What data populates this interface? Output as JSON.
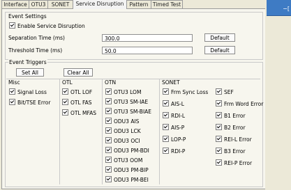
{
  "tabs": [
    "Interface",
    "OTU3",
    "SONET",
    "Service Disruption",
    "Pattern",
    "Timed Test"
  ],
  "active_tab": "Service Disruption",
  "right_glyph": "−[",
  "event_settings": {
    "title": "Event Settings",
    "enable_label": "Enable Service Disruption",
    "enable_checked": true,
    "separation_label": "Separation Time (ms)",
    "separation_value": "300.0",
    "threshold_label": "Threshold Time (ms)",
    "threshold_value": "50.0",
    "default_label": "Default"
  },
  "event_triggers": {
    "title": "Event Triggers",
    "set_all": "Set All",
    "clear_all": "Clear All",
    "misc": {
      "title": "Misc",
      "items": [
        {
          "label": "Signal Loss",
          "checked": true
        },
        {
          "label": "Bit/TSE Error",
          "checked": true
        }
      ]
    },
    "otl": {
      "title": "OTL",
      "items": [
        {
          "label": "OTL LOF",
          "checked": true
        },
        {
          "label": "OTL FAS",
          "checked": true
        },
        {
          "label": "OTL MFAS",
          "checked": true
        }
      ]
    },
    "otn": {
      "title": "OTN",
      "items": [
        {
          "label": "OTU3 LOM",
          "checked": true
        },
        {
          "label": "OTU3 SM-IAE",
          "checked": true
        },
        {
          "label": "OTU3 SM-BIAE",
          "checked": true
        },
        {
          "label": "ODU3 AIS",
          "checked": true
        },
        {
          "label": "ODU3 LCK",
          "checked": true
        },
        {
          "label": "ODU3 OCI",
          "checked": true
        },
        {
          "label": "ODU3 PM-BDI",
          "checked": true
        },
        {
          "label": "OTU3 OOM",
          "checked": true
        },
        {
          "label": "ODU3 PM-BIP",
          "checked": true
        },
        {
          "label": "ODU3 PM-BEI",
          "checked": true
        }
      ]
    },
    "sonet": {
      "title": "SONET",
      "col1": [
        {
          "label": "Frm Sync Loss",
          "checked": true
        },
        {
          "label": "AIS-L",
          "checked": true
        },
        {
          "label": "RDI-L",
          "checked": true
        },
        {
          "label": "AIS-P",
          "checked": true
        },
        {
          "label": "LOP-P",
          "checked": true
        },
        {
          "label": "RDI-P",
          "checked": true
        }
      ],
      "col2": [
        {
          "label": "SEF",
          "checked": true
        },
        {
          "label": "Frm Word Error",
          "checked": true
        },
        {
          "label": "B1 Error",
          "checked": true
        },
        {
          "label": "B2 Error",
          "checked": true
        },
        {
          "label": "REI-L Error",
          "checked": true
        },
        {
          "label": "B3 Error",
          "checked": true
        },
        {
          "label": "REI-P Error",
          "checked": true
        }
      ]
    }
  }
}
